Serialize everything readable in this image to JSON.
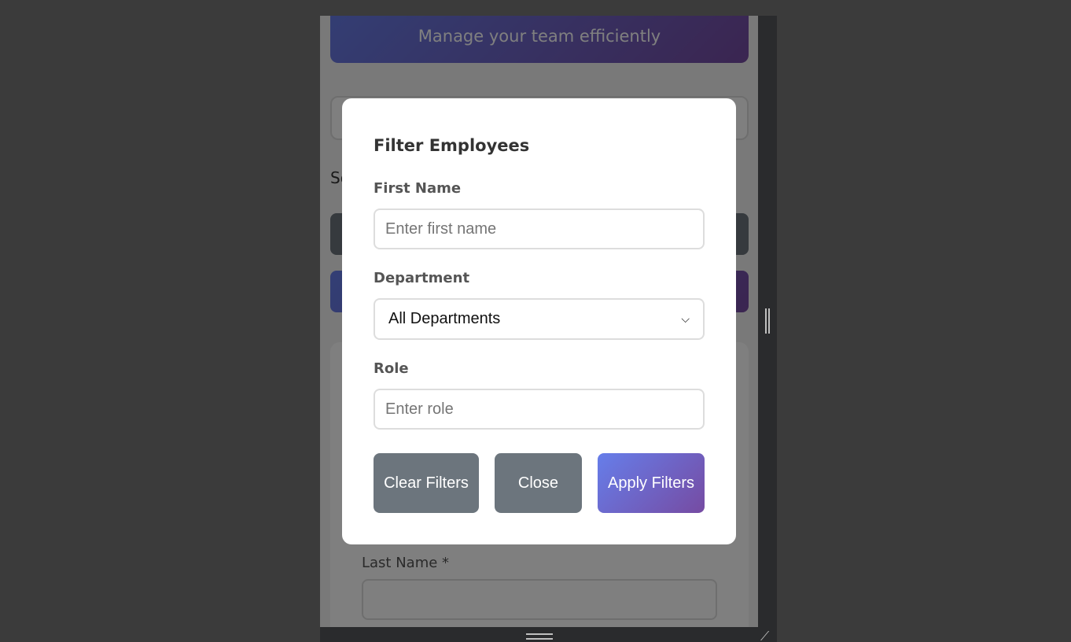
{
  "page": {
    "hero_subtitle": "Manage your team efficiently",
    "sort_label_partial": "So",
    "last_name_label": "Last Name *"
  },
  "modal": {
    "title": "Filter Employees",
    "first_name": {
      "label": "First Name",
      "placeholder": "Enter first name",
      "value": ""
    },
    "department": {
      "label": "Department",
      "selected": "All Departments"
    },
    "role": {
      "label": "Role",
      "placeholder": "Enter role",
      "value": ""
    },
    "buttons": {
      "clear": "Clear Filters",
      "close": "Close",
      "apply": "Apply Filters"
    }
  },
  "colors": {
    "accent_start": "#667eea",
    "accent_end": "#764ba2",
    "secondary_button": "#6c757d"
  }
}
